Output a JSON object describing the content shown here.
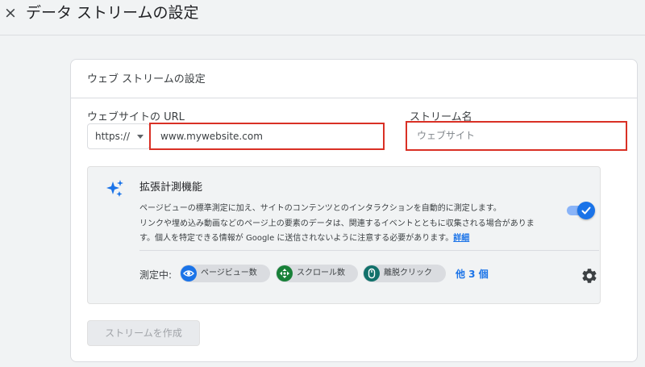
{
  "header": {
    "close_icon": "×",
    "title": "データ ストリームの設定"
  },
  "card": {
    "title": "ウェブ ストリームの設定",
    "url_field": {
      "label": "ウェブサイトの URL",
      "protocol": "https://",
      "value": "www.mywebsite.com"
    },
    "name_field": {
      "label": "ストリーム名",
      "placeholder": "ウェブサイト"
    },
    "enhanced": {
      "icon": "sparkle-icon",
      "title": "拡張計測機能",
      "description_lines": [
        "ページビューの標準測定に加え、サイトのコンテンツとのインタラクションを自動的に測定します。",
        "リンクや埋め込み動画などのページ上の要素のデータは、関連するイベントとともに収集される場合がありま",
        "す。個人を特定できる情報が Google に送信されないように注意する必要があります。"
      ],
      "detail_link": "詳細",
      "toggle_on": true,
      "measuring_label": "測定中:",
      "chips": [
        {
          "label": "ページビュー数",
          "icon": "eye-icon",
          "color": "#1a73e8"
        },
        {
          "label": "スクロール数",
          "icon": "scroll-icon",
          "color": "#188038"
        },
        {
          "label": "離脱クリック",
          "icon": "mouse-icon",
          "color": "#12716b"
        }
      ],
      "more_link": "他 3 個",
      "settings_icon": "gear-icon"
    },
    "create_button": "ストリームを作成"
  },
  "colors": {
    "accent": "#1a73e8",
    "highlight_border": "#d93025",
    "background": "#f1f3f4"
  }
}
